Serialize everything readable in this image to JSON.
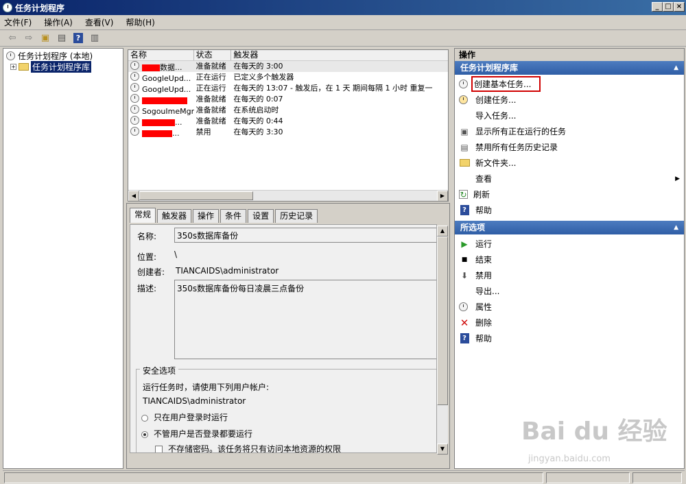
{
  "window": {
    "title": "任务计划程序"
  },
  "menu": [
    "文件(F)",
    "操作(A)",
    "查看(V)",
    "帮助(H)"
  ],
  "tree": {
    "root": "任务计划程序 (本地)",
    "child": "任务计划程序库"
  },
  "tasklist": {
    "columns": [
      "名称",
      "状态",
      "触发器"
    ],
    "rows": [
      {
        "name": "数据...",
        "status": "准备就绪",
        "trigger": "在每天的 3:00"
      },
      {
        "name": "GoogleUpd...",
        "status": "正在运行",
        "trigger": "已定义多个触发器"
      },
      {
        "name": "GoogleUpd...",
        "status": "正在运行",
        "trigger": "在每天的 13:07 - 触发后，在 1 天 期间每隔 1 小时 重复一"
      },
      {
        "name": "",
        "status": "准备就绪",
        "trigger": "在每天的 0:07"
      },
      {
        "name": "SogouImeMgr",
        "status": "准备就绪",
        "trigger": "在系统启动时"
      },
      {
        "name": "...",
        "status": "准备就绪",
        "trigger": "在每天的 0:44"
      },
      {
        "name": "...",
        "status": "禁用",
        "trigger": "在每天的 3:30"
      }
    ]
  },
  "detail": {
    "tabs": [
      "常规",
      "触发器",
      "操作",
      "条件",
      "设置",
      "历史记录"
    ],
    "name_label": "名称:",
    "name_value": "350s数据库备份",
    "location_label": "位置:",
    "location_value": "\\",
    "author_label": "创建者:",
    "author_value": "TIANCAIDS\\administrator",
    "desc_label": "描述:",
    "desc_value": "350s数据库备份每日凌晨三点备份",
    "security_title": "安全选项",
    "security_prompt": "运行任务时，请使用下列用户帐户:",
    "security_user": "TIANCAIDS\\administrator",
    "opt1": "只在用户登录时运行",
    "opt2": "不管用户是否登录都要运行",
    "opt3": "不存储密码。该任务将只有访问本地资源的权限"
  },
  "actions": {
    "header": "操作",
    "section1": "任务计划程序库",
    "items1": [
      "创建基本任务...",
      "创建任务...",
      "导入任务...",
      "显示所有正在运行的任务",
      "禁用所有任务历史记录",
      "新文件夹...",
      "查看",
      "刷新",
      "帮助"
    ],
    "section2": "所选项",
    "items2": [
      "运行",
      "结束",
      "禁用",
      "导出...",
      "属性",
      "删除",
      "帮助"
    ]
  },
  "watermark": {
    "brand": "Bai du 经验",
    "url": "jingyan.baidu.com"
  },
  "colors": {
    "highlight_box": "#d00000",
    "section_bar": "#3a68b0"
  }
}
